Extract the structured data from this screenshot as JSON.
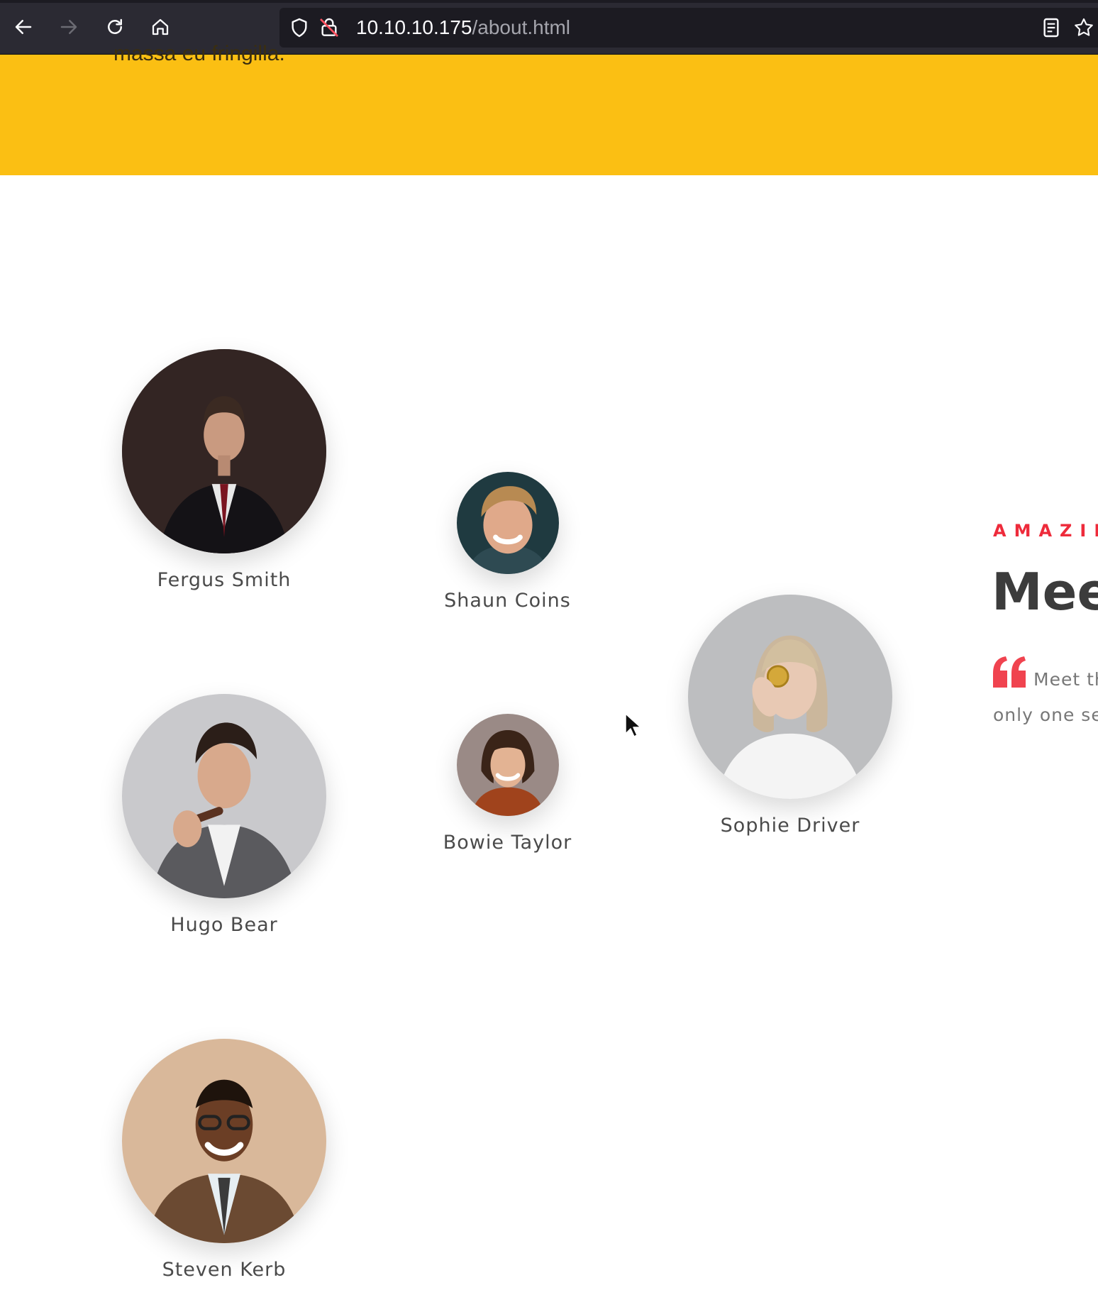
{
  "browser": {
    "url_host": "10.10.10.175",
    "url_path": "/about.html"
  },
  "banner": {
    "text": "massa eu fringilla."
  },
  "team": [
    {
      "name": "Fergus Smith"
    },
    {
      "name": "Shaun Coins"
    },
    {
      "name": "Hugo Bear"
    },
    {
      "name": "Bowie Taylor"
    },
    {
      "name": "Sophie Driver"
    },
    {
      "name": "Steven Kerb"
    }
  ],
  "intro": {
    "eyebrow": "AMAZINC",
    "headline": "Meet",
    "quote_line1": "Meet th",
    "quote_line2": "only one sec"
  },
  "colors": {
    "banner": "#fbbf13",
    "accent": "#ee2b3b",
    "toolbar": "#2b2a33"
  }
}
